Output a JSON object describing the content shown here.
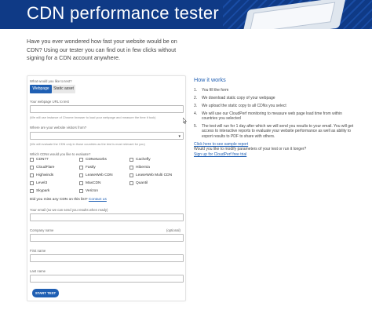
{
  "hero": {
    "title": "CDN performance tester"
  },
  "intro": {
    "text": "Have you ever wondered how fast your website would be on CDN? Using our tester you can find out in few clicks without signing for a CDN account anywhere."
  },
  "form": {
    "what_label": "What would you like to test?",
    "tabs": [
      {
        "label": "Webpage",
        "active": true
      },
      {
        "label": "Static asset",
        "active": false
      }
    ],
    "url_label": "Your webpage URL to test",
    "url_value": "",
    "url_hint": "(We will use instance of Chrome browser to load your webpage and measure the time it took)",
    "where_label": "Where are your website visitors from?",
    "where_value": "",
    "where_hint": "(We will evaluate the CDN only in those countries as the test is most relevant for you)",
    "cdns_label": "Which CDNs would you like to evaluate?",
    "cdns": [
      [
        "CDN77",
        "CDNetworks",
        "Cachefly"
      ],
      [
        "CloudFlare",
        "Fastly",
        "Hibernia"
      ],
      [
        "Highwinds",
        "LeaseWeb CDN",
        "LeaseWeb Multi CDN"
      ],
      [
        "Level3",
        "MaxCDN",
        "Quantil"
      ],
      [
        "Skypark",
        "Verizon",
        ""
      ]
    ],
    "missing_text": "Did you miss any CDN on this list?",
    "contact_link": "Contact us",
    "email_label": "Your email (so we can send you results when ready)",
    "email_value": "",
    "company_label": "Company name",
    "company_optional": "(optional)",
    "company_value": "",
    "first_label": "First name",
    "first_value": "",
    "last_label": "Last name",
    "last_value": "",
    "start_button": "START TEST"
  },
  "how": {
    "title": "How it works",
    "steps": [
      {
        "num": "1.",
        "text": "You fill the form"
      },
      {
        "num": "2.",
        "text": "We download static copy of your webpage"
      },
      {
        "num": "3.",
        "text": "We upload the static copy to all CDNs you select"
      },
      {
        "num": "4.",
        "text": "We will use our CloudPerf monitoring to measure web page load time from within countries you selected"
      },
      {
        "num": "5.",
        "text": "The test will run for 1 day after which we will send you results to your email. You will get access to interactive reports to evaluate your website performance as well as ability to export results to PDF to share with others."
      }
    ],
    "sample_link": "Click here to see sample report",
    "modify_text": "Would you like to modify parameters of your test or run it longer?",
    "signup_link": "Sign up for CloudPerf free trial"
  },
  "colors": {
    "brand": "#1f5fb3",
    "hero_bg": "#0f3a86"
  },
  "icons": {
    "select_arrow": "chevron-down-icon",
    "cursor": "mouse-cursor-icon"
  }
}
